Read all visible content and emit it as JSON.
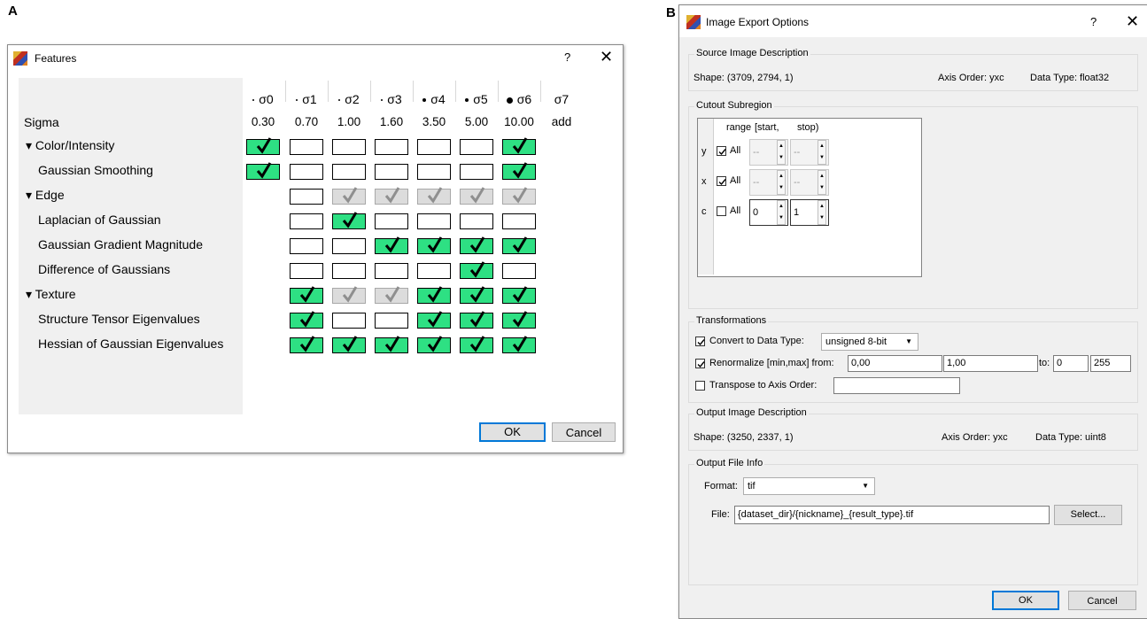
{
  "panel_a_letter": "A",
  "panel_b_letter": "B",
  "features": {
    "title": "Features",
    "help": "?",
    "close": "✕",
    "sigma_headers": [
      "σ0",
      "σ1",
      "σ2",
      "σ3",
      "σ4",
      "σ5",
      "σ6",
      "σ7"
    ],
    "sigma_label": "Sigma",
    "sigma_values": [
      "0.30",
      "0.70",
      "1.00",
      "1.60",
      "3.50",
      "5.00",
      "10.00",
      "add"
    ],
    "rows": [
      {
        "label": "▾ Color/Intensity",
        "group": true,
        "cells": [
          "on",
          "off",
          "off",
          "off",
          "off",
          "off",
          "on"
        ]
      },
      {
        "label": "Gaussian Smoothing",
        "group": false,
        "cells": [
          "on",
          "off",
          "off",
          "off",
          "off",
          "off",
          "on"
        ]
      },
      {
        "label": "▾ Edge",
        "group": true,
        "cells": [
          "none",
          "off",
          "gray",
          "gray",
          "gray",
          "gray",
          "gray"
        ]
      },
      {
        "label": "Laplacian of Gaussian",
        "group": false,
        "cells": [
          "none",
          "off",
          "on",
          "off",
          "off",
          "off",
          "off"
        ]
      },
      {
        "label": "Gaussian Gradient Magnitude",
        "group": false,
        "cells": [
          "none",
          "off",
          "off",
          "on",
          "on",
          "on",
          "on"
        ]
      },
      {
        "label": "Difference of Gaussians",
        "group": false,
        "cells": [
          "none",
          "off",
          "off",
          "off",
          "off",
          "on",
          "off"
        ]
      },
      {
        "label": "▾ Texture",
        "group": true,
        "cells": [
          "none",
          "on",
          "gray",
          "gray",
          "on",
          "on",
          "on"
        ]
      },
      {
        "label": "Structure Tensor Eigenvalues",
        "group": false,
        "cells": [
          "none",
          "on",
          "off",
          "off",
          "on",
          "on",
          "on"
        ]
      },
      {
        "label": "Hessian of Gaussian Eigenvalues",
        "group": false,
        "cells": [
          "none",
          "on",
          "on",
          "on",
          "on",
          "on",
          "on"
        ]
      }
    ],
    "ok": "OK",
    "cancel": "Cancel",
    "colors": {
      "on": "#2ee083",
      "gray": "#dcdcdc"
    }
  },
  "export": {
    "title": "Image Export Options",
    "help": "?",
    "close": "✕",
    "source": {
      "group_title": "Source Image Description",
      "shape": "Shape: (3709, 2794, 1)",
      "axis_order": "Axis Order: yxc",
      "data_type": "Data Type: float32"
    },
    "cutout": {
      "group_title": "Cutout Subregion",
      "col_range": "range",
      "col_start": "[start,",
      "col_stop": "stop)",
      "rows": [
        {
          "axis": "y",
          "checked": true,
          "all": "All",
          "start": "--",
          "stop": "--"
        },
        {
          "axis": "x",
          "checked": true,
          "all": "All",
          "start": "--",
          "stop": "--"
        },
        {
          "axis": "c",
          "checked": false,
          "all": "All",
          "start": "0",
          "stop": "1"
        }
      ]
    },
    "transformations": {
      "group_title": "Transformations",
      "convert_label": "Convert to Data Type:",
      "convert_checked": true,
      "dtype": "unsigned 8-bit",
      "renorm_label": "Renormalize [min,max] from:",
      "renorm_checked": true,
      "from_min": "0,00",
      "from_max": "1,00",
      "to_label": "to:",
      "to_min": "0",
      "to_max": "255",
      "transpose_label": "Transpose to Axis Order:",
      "transpose_checked": false,
      "transpose_value": ""
    },
    "output_desc": {
      "group_title": "Output Image Description",
      "shape": "Shape: (3250, 2337, 1)",
      "axis_order": "Axis Order: yxc",
      "data_type": "Data Type: uint8"
    },
    "output_file": {
      "group_title": "Output File Info",
      "format_label": "Format:",
      "format": "tif",
      "file_label": "File:",
      "file": "{dataset_dir}/{nickname}_{result_type}.tif",
      "select": "Select..."
    },
    "ok": "OK",
    "cancel": "Cancel"
  }
}
